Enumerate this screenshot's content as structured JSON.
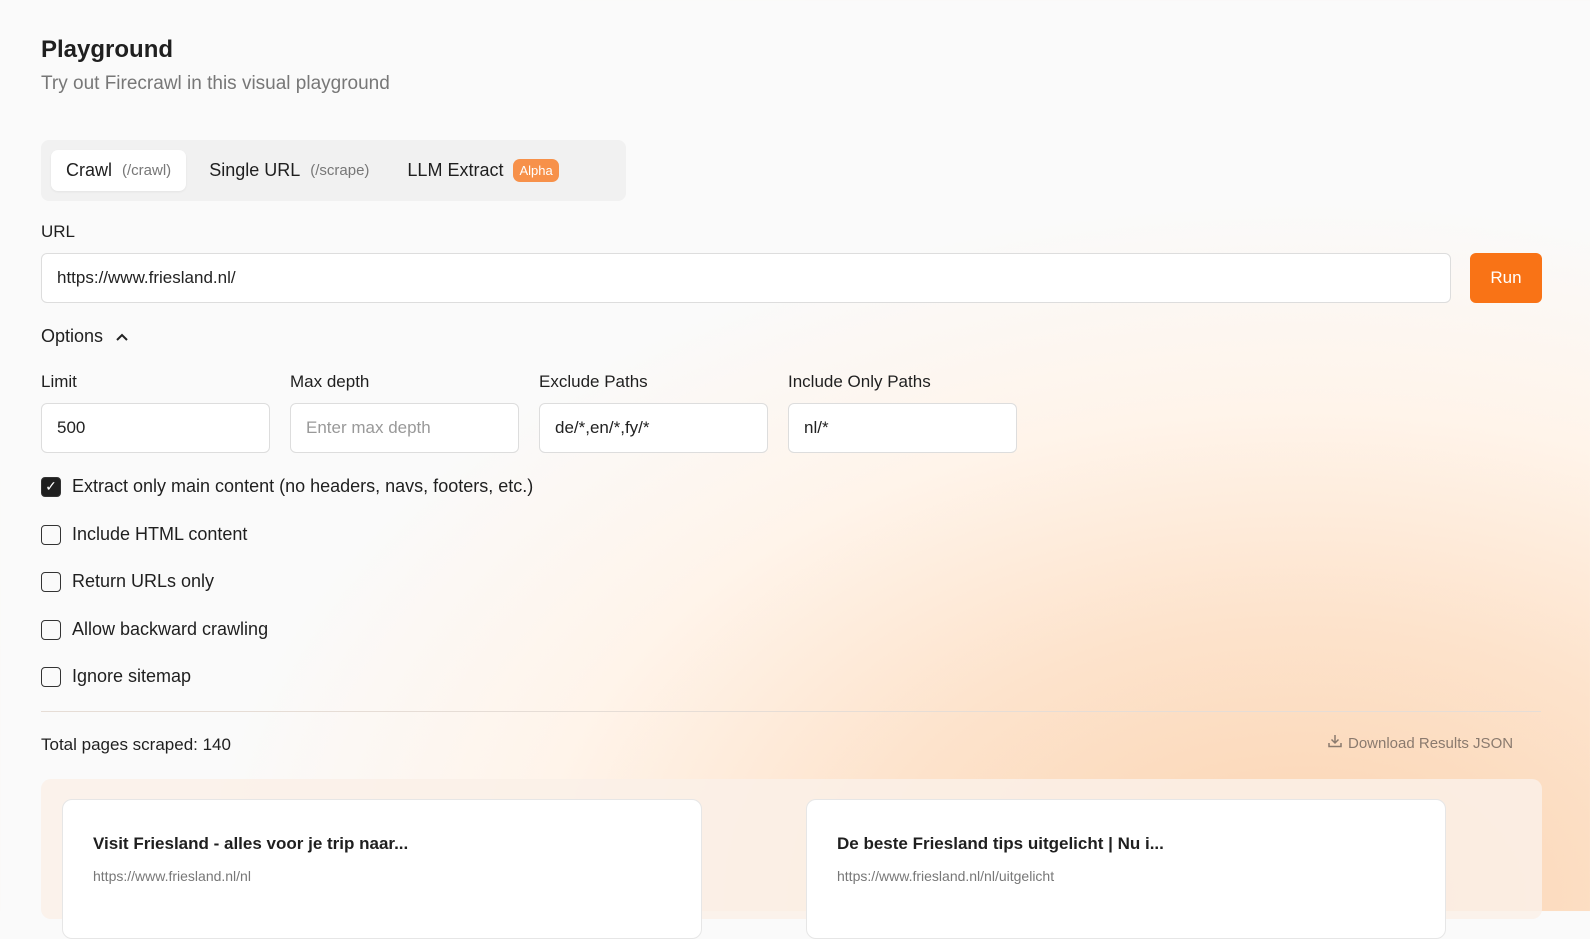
{
  "header": {
    "title": "Playground",
    "subtitle": "Try out Firecrawl in this visual playground"
  },
  "tabs": [
    {
      "label": "Crawl",
      "hint": "(/crawl)"
    },
    {
      "label": "Single URL",
      "hint": "(/scrape)"
    },
    {
      "label": "LLM Extract",
      "badge": "Alpha"
    }
  ],
  "url": {
    "label": "URL",
    "value": "https://www.friesland.nl/"
  },
  "run_label": "Run",
  "options_label": "Options",
  "fields": [
    {
      "label": "Limit",
      "value": "500",
      "placeholder": ""
    },
    {
      "label": "Max depth",
      "value": "",
      "placeholder": "Enter max depth"
    },
    {
      "label": "Exclude Paths",
      "value": "de/*,en/*,fy/*",
      "placeholder": ""
    },
    {
      "label": "Include Only Paths",
      "value": "nl/*",
      "placeholder": ""
    }
  ],
  "checkboxes": [
    {
      "label": "Extract only main content (no headers, navs, footers, etc.)",
      "checked": true
    },
    {
      "label": "Include HTML content",
      "checked": false
    },
    {
      "label": "Return URLs only",
      "checked": false
    },
    {
      "label": "Allow backward crawling",
      "checked": false
    },
    {
      "label": "Ignore sitemap",
      "checked": false
    }
  ],
  "total": "Total pages scraped: 140",
  "download_label": "Download Results JSON",
  "results": [
    {
      "title": "Visit Friesland - alles voor je trip naar...",
      "url": "https://www.friesland.nl/nl"
    },
    {
      "title": "De beste Friesland tips uitgelicht | Nu i...",
      "url": "https://www.friesland.nl/nl/uitgelicht"
    }
  ]
}
